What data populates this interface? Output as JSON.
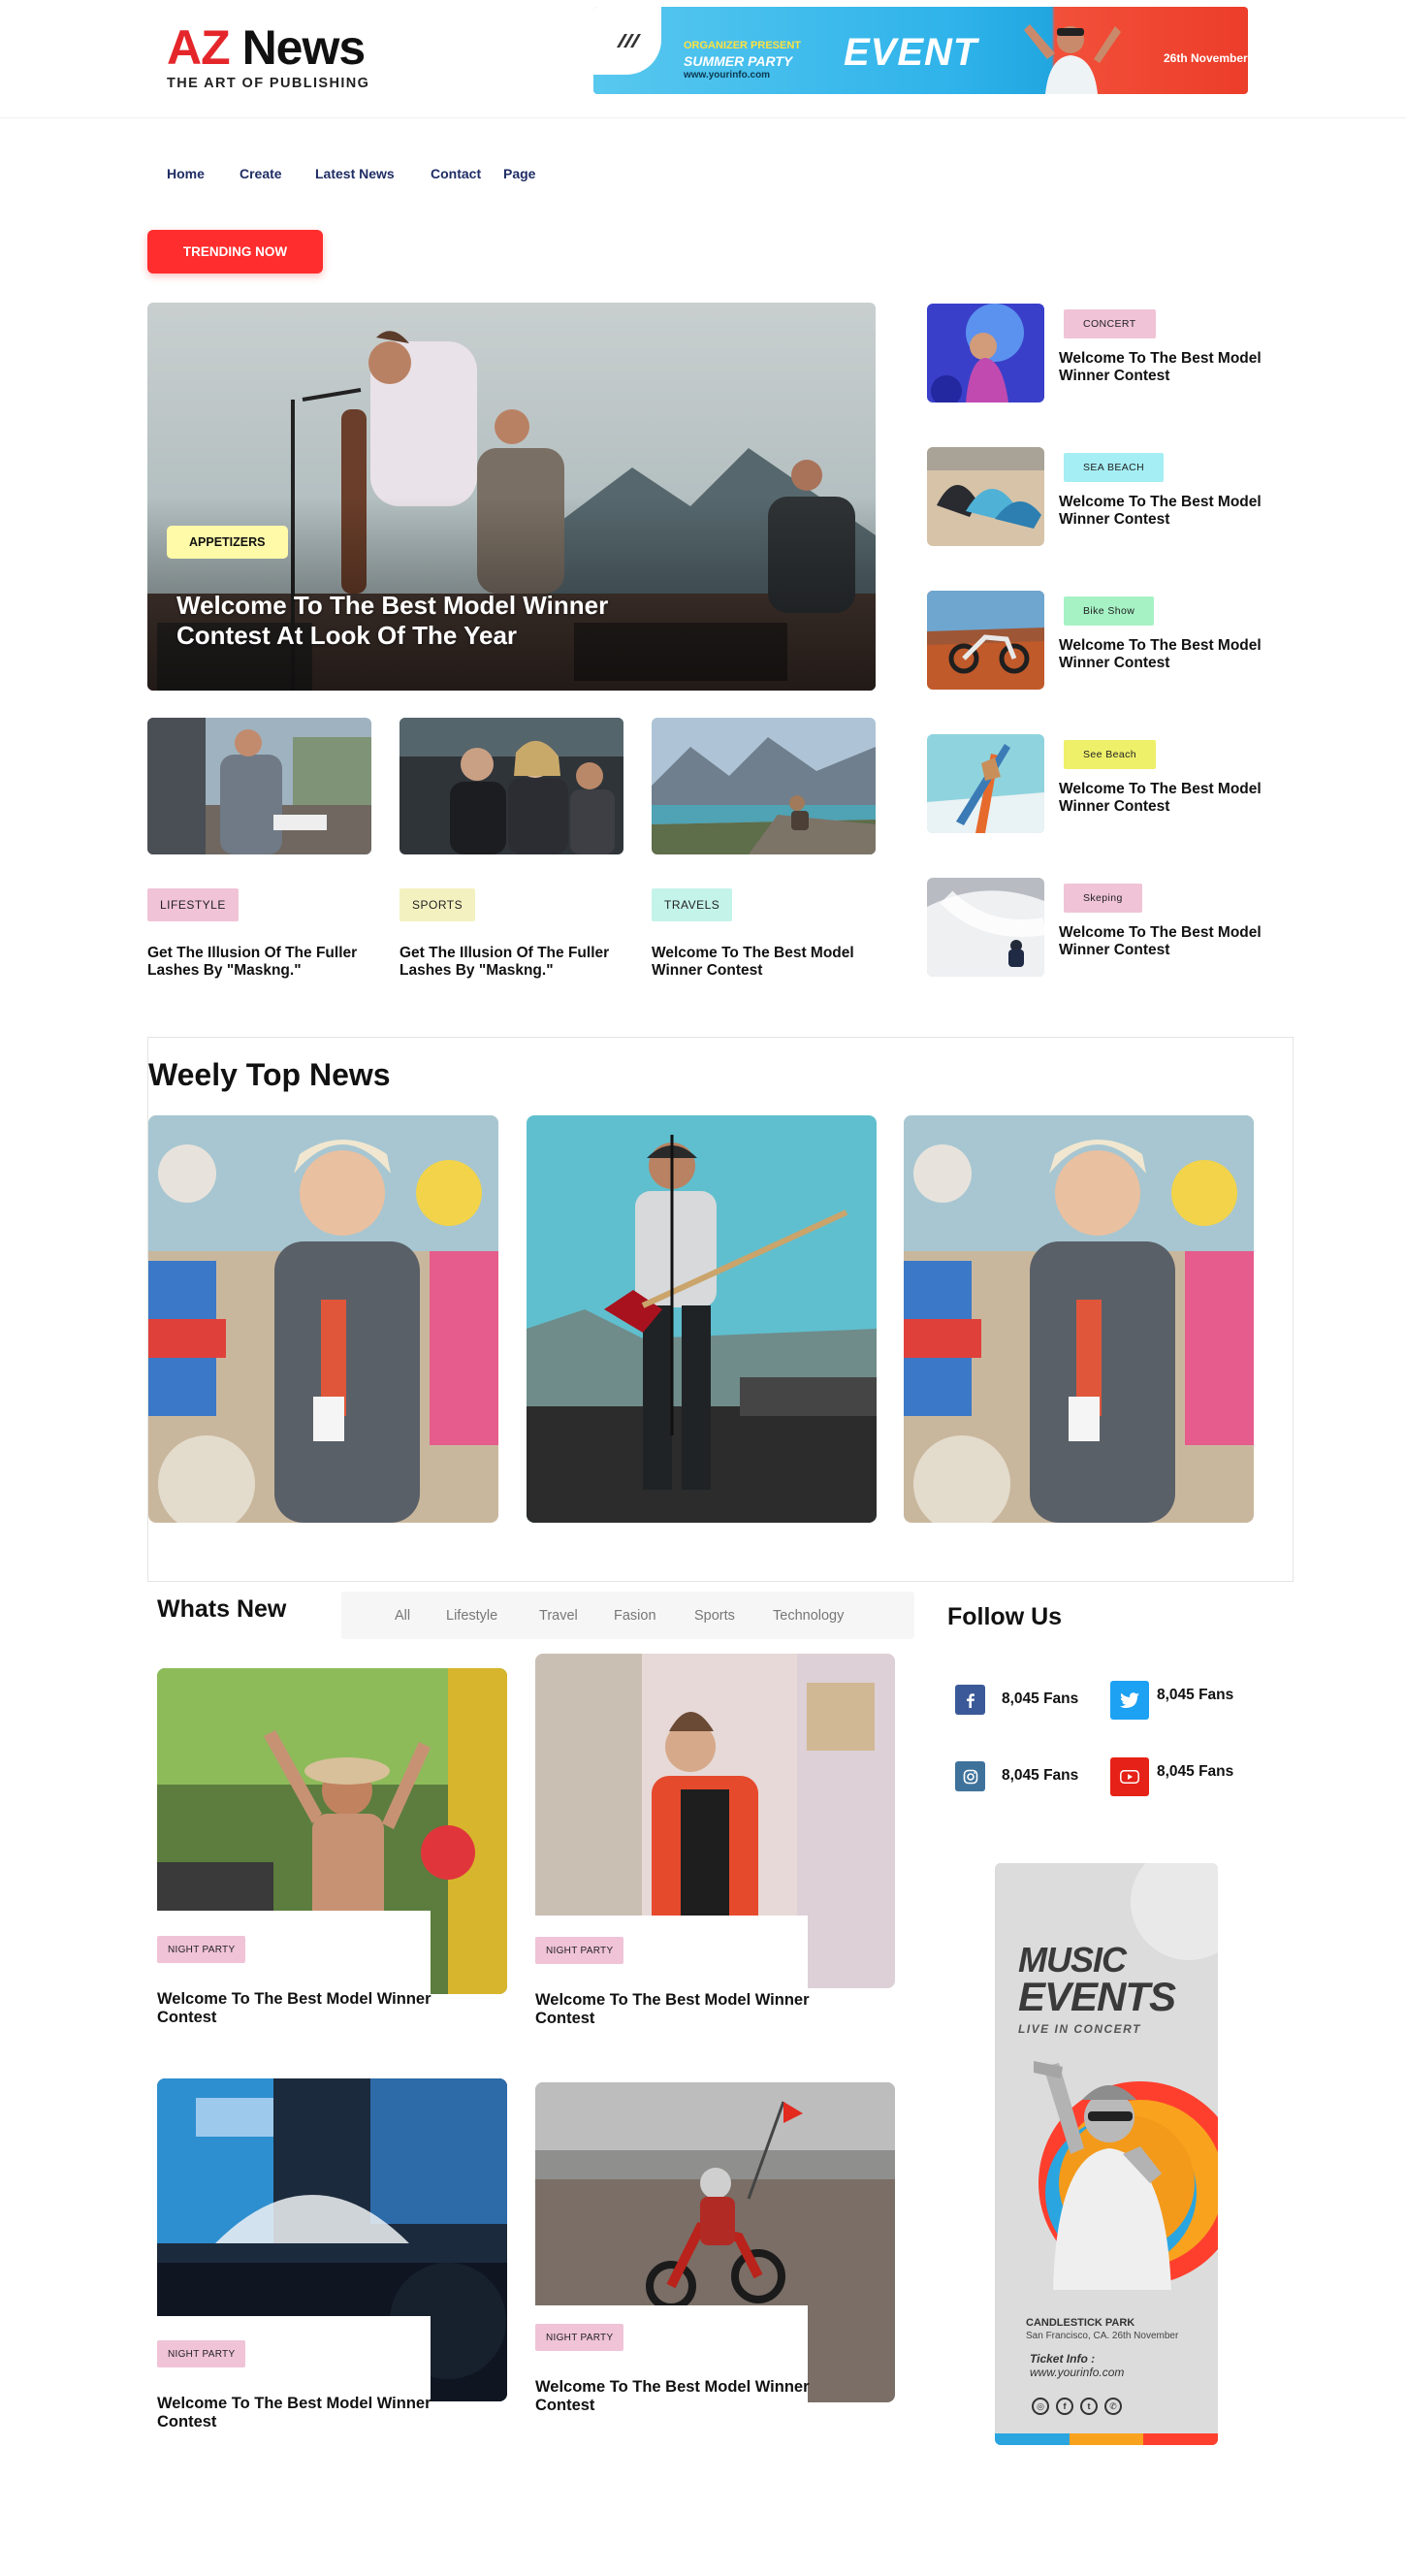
{
  "header": {
    "logo_az": "AZ",
    "logo_news": "News",
    "logo_tagline": "THE ART OF PUBLISHING",
    "banner": {
      "org": "ORGANIZER PRESENT",
      "party": "SUMMER PARTY",
      "url": "www.yourinfo.com",
      "event": "EVENT",
      "date": "26th November"
    }
  },
  "nav": [
    "Home",
    "Create",
    "Latest News",
    "Contact",
    "Page"
  ],
  "trending_label": "TRENDING NOW",
  "hero": {
    "tag": "APPETIZERS",
    "title": "Welcome To The Best Model Winner Contest At Look Of The Year"
  },
  "small_cards": [
    {
      "tag": "LIFESTYLE",
      "title": "Get The Illusion Of The Fuller Lashes By \"Maskng.\""
    },
    {
      "tag": "SPORTS",
      "title": "Get The Illusion Of The Fuller Lashes By \"Maskng.\""
    },
    {
      "tag": "TRAVELS",
      "title": "Welcome To The Best Model Winner Contest"
    }
  ],
  "right_list": [
    {
      "tag": "CONCERT",
      "title": "Welcome To The Best Model Winner Contest"
    },
    {
      "tag": "SEA BEACH",
      "title": "Welcome To The Best Model Winner Contest"
    },
    {
      "tag": "Bike Show",
      "title": "Welcome To The Best Model Winner Contest"
    },
    {
      "tag": "See Beach",
      "title": "Welcome To The Best Model Winner Contest"
    },
    {
      "tag": "Skeping",
      "title": "Welcome To The Best Model Winner Contest"
    }
  ],
  "weekly": {
    "title": "Weely Top News"
  },
  "whats_new": {
    "title": "Whats New",
    "filters": [
      "All",
      "Lifestyle",
      "Travel",
      "Fasion",
      "Sports",
      "Technology"
    ],
    "cards": [
      {
        "tag": "NIGHT PARTY",
        "title": "Welcome To The Best Model Winner Contest"
      },
      {
        "tag": "NIGHT PARTY",
        "title": "Welcome To The Best Model Winner Contest"
      },
      {
        "tag": "NIGHT PARTY",
        "title": "Welcome To The Best Model Winner Contest"
      },
      {
        "tag": "NIGHT PARTY",
        "title": "Welcome To The Best Model Winner Contest"
      }
    ]
  },
  "follow": {
    "title": "Follow Us",
    "items": [
      {
        "network": "facebook-icon",
        "count": "8,045 Fans",
        "color": "#3b5998"
      },
      {
        "network": "twitter-icon",
        "count": "8,045 Fans",
        "color": "#1da1f2"
      },
      {
        "network": "instagram-icon",
        "count": "8,045 Fans",
        "color": "#3f729b"
      },
      {
        "network": "youtube-icon",
        "count": "8,045 Fans",
        "color": "#e62117"
      }
    ]
  },
  "ad": {
    "title1": "MUSIC",
    "title2": "EVENTS",
    "subtitle": "LIVE IN CONCERT",
    "venue": "CANDLESTICK PARK",
    "address": "San Francisco, CA. 26th November",
    "ticket_label": "Ticket Info :",
    "url": "www.yourinfo.com"
  },
  "colors": {
    "accent_red": "#ff2d2d",
    "nav_text": "#1e2d64",
    "tag_pink": "#f0c3d7",
    "tag_yellow": "#fffaa8",
    "tag_cream": "#f4f1c1",
    "tag_mint": "#c4f3ea",
    "tag_cyan": "#a5eef4",
    "tag_green": "#a6f2c5",
    "tag_lime": "#eef06a"
  }
}
